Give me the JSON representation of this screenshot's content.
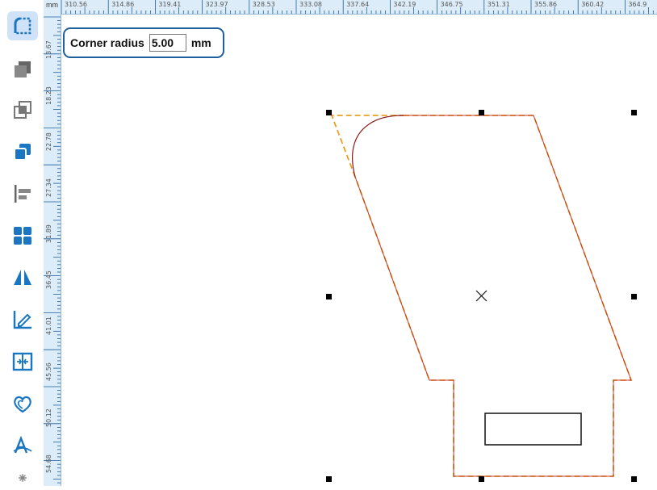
{
  "toolbar": {
    "tools": [
      {
        "name": "round-corner-icon",
        "active": true
      },
      {
        "name": "shadow-icon",
        "active": false
      },
      {
        "name": "overlap-icon",
        "active": false
      },
      {
        "name": "combine-icon",
        "active": false
      },
      {
        "name": "align-left-icon",
        "active": false
      },
      {
        "name": "grid-icon",
        "active": false
      },
      {
        "name": "mirror-icon",
        "active": false
      },
      {
        "name": "edit-angle-icon",
        "active": false
      },
      {
        "name": "split-icon",
        "active": false
      },
      {
        "name": "outline-icon",
        "active": false
      },
      {
        "name": "text-path-icon",
        "active": false
      },
      {
        "name": "more-icon",
        "active": false
      }
    ],
    "accent": "#1a76c2"
  },
  "ruler": {
    "unit": "mm",
    "top_labels": [
      "310.56",
      "314.86",
      "319.41",
      "323.97",
      "328.53",
      "333.08",
      "337.64",
      "342.19",
      "346.75",
      "351.31",
      "355.86",
      "360.42",
      "364.9"
    ],
    "left_labels": [
      "13.67",
      "18.23",
      "22.78",
      "27.34",
      "31.89",
      "36.45",
      "41.01",
      "45.56",
      "50.12",
      "54.68"
    ]
  },
  "corner_tool": {
    "label": "Corner radius",
    "value": "5.00",
    "unit": "mm"
  },
  "colors": {
    "shape_outline": "#c0392b",
    "preview_dash": "#e8a020",
    "selection_handle": "#000000"
  }
}
